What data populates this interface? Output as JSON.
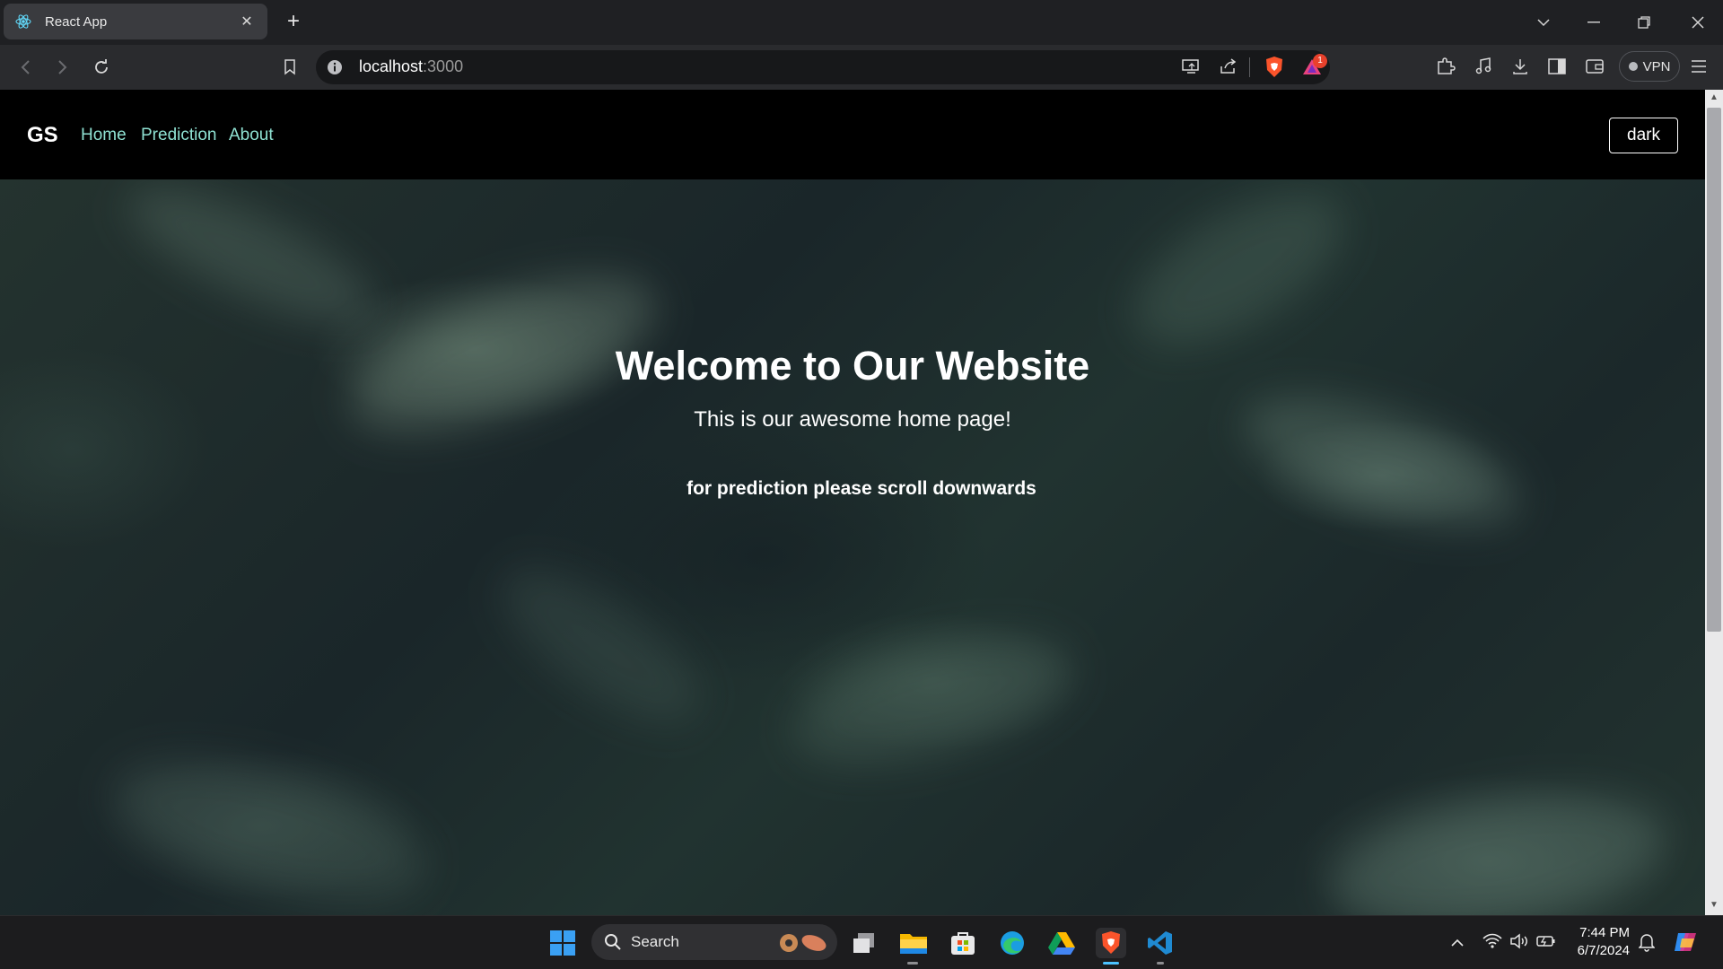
{
  "browser": {
    "tab": {
      "title": "React App"
    },
    "url": {
      "host": "localhost",
      "port": ":3000"
    },
    "vpn_label": "VPN",
    "notification_count": "1"
  },
  "navbar": {
    "brand": "GS",
    "links": [
      "Home",
      "Prediction",
      "About"
    ],
    "theme_button": "dark"
  },
  "hero": {
    "title": "Welcome to Our Website",
    "subtitle": "This is our awesome home page!",
    "hint": "for prediction please scroll downwards"
  },
  "taskbar": {
    "search_label": "Search",
    "time": "7:44 PM",
    "date": "6/7/2024"
  },
  "colors": {
    "nav_link": "#8fe1d2",
    "navbar_bg": "#000000",
    "hero_text": "#ffffff"
  }
}
